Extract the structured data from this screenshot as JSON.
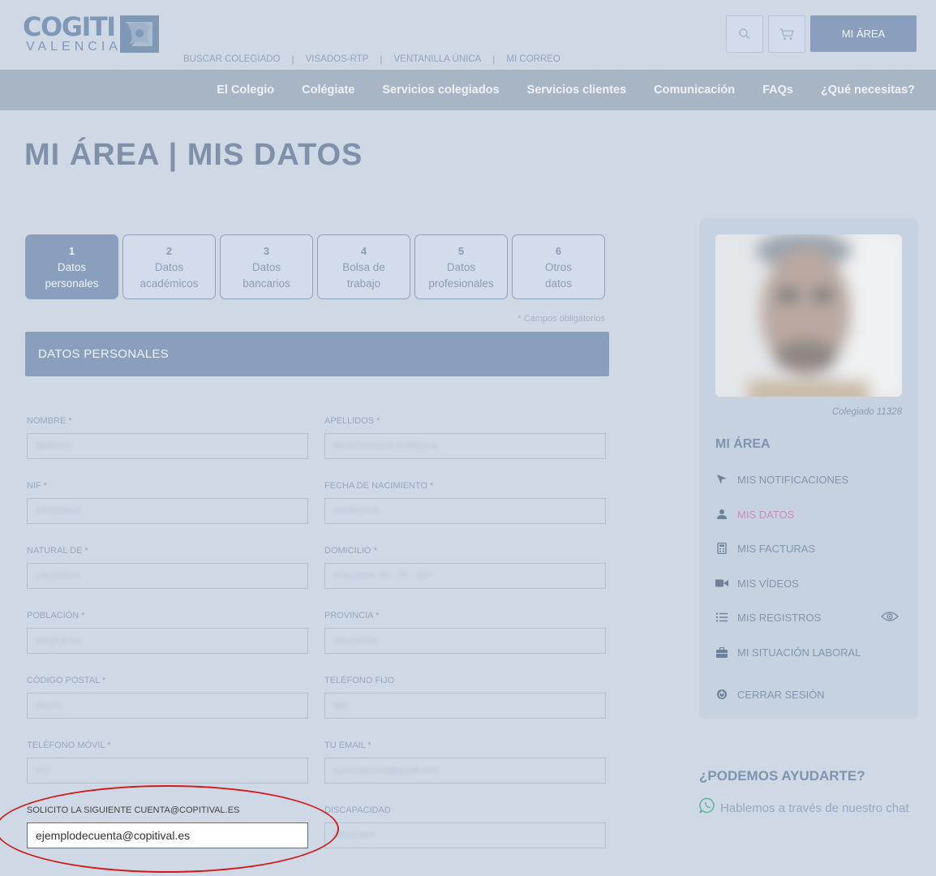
{
  "header": {
    "logo_main": "COGITI",
    "logo_sub": "VALENCIA",
    "top_links": [
      "BUSCAR COLEGIADO",
      "VISADOS-RTP",
      "VENTANILLA ÚNICA",
      "MI CORREO"
    ],
    "search_icon": "search-icon",
    "cart_icon": "cart-icon",
    "mi_area_label": "MI ÁREA"
  },
  "nav": {
    "items": [
      "El Colegio",
      "Colégiate",
      "Servicios colegiados",
      "Servicios clientes",
      "Comunicación",
      "FAQs",
      "¿Qué necesitas?"
    ]
  },
  "page": {
    "title": "MI ÁREA | MIS DATOS"
  },
  "tabs": [
    {
      "num": "1",
      "line1": "Datos",
      "line2": "personales",
      "active": true
    },
    {
      "num": "2",
      "line1": "Datos",
      "line2": "académicos",
      "active": false
    },
    {
      "num": "3",
      "line1": "Datos",
      "line2": "bancarios",
      "active": false
    },
    {
      "num": "4",
      "line1": "Bolsa de",
      "line2": "trabajo",
      "active": false
    },
    {
      "num": "5",
      "line1": "Datos",
      "line2": "profesionales",
      "active": false
    },
    {
      "num": "6",
      "line1": "Otros",
      "line2": "datos",
      "active": false
    }
  ],
  "form": {
    "required_note": "* Campos obligatorios",
    "section_title": "DATOS PERSONALES",
    "fields": {
      "nombre": {
        "label": "NOMBRE *",
        "value": "SERGIO"
      },
      "apellidos": {
        "label": "APELLIDOS *",
        "value": "MONTESINOS CORELLA"
      },
      "nif": {
        "label": "NIF *",
        "value": "29958384Z"
      },
      "fecha_nacimiento": {
        "label": "FECHA DE NACIMIENTO *",
        "value": "04/06/1978"
      },
      "natural_de": {
        "label": "NATURAL DE *",
        "value": "VALENCIA"
      },
      "domicilio": {
        "label": "DOMICILIO *",
        "value": "SOLLANA, 35 - 7P - 32F"
      },
      "poblacion": {
        "label": "POBLACIÓN *",
        "value": "MAQUERA"
      },
      "provincia": {
        "label": "PROVINCIA *",
        "value": "VALENCIA"
      },
      "codigo_postal": {
        "label": "CÓDIGO POSTAL *",
        "value": "46135"
      },
      "telefono_fijo": {
        "label": "TELÉFONO FIJO",
        "value": "961"
      },
      "telefono_movil": {
        "label": "TELÉFONO MÓVIL *",
        "value": "657"
      },
      "email": {
        "label": "TU EMAIL *",
        "value": "sgmontesinos@gmail.com"
      },
      "cuenta": {
        "label": "SOLICITO LA SIGUIENTE CUENTA@COPITIVAL.ES",
        "value": "ejemplodecuenta@copitival.es"
      },
      "discapacidad": {
        "label": "DISCAPACIDAD",
        "value": "NINGUNA"
      }
    }
  },
  "sidebar": {
    "colegiado": "Colegiado 11328",
    "title": "MI ÁREA",
    "items": [
      {
        "label": "MIS NOTIFICACIONES",
        "icon": "send-icon"
      },
      {
        "label": "MIS DATOS",
        "icon": "user-icon",
        "active": true
      },
      {
        "label": "MIS FACTURAS",
        "icon": "calculator-icon"
      },
      {
        "label": "MIS VÍDEOS",
        "icon": "video-icon"
      },
      {
        "label": "MIS REGISTROS",
        "icon": "list-icon"
      },
      {
        "label": "MI SITUACIÓN LABORAL",
        "icon": "briefcase-icon"
      },
      {
        "label": "CERRAR SESIÓN",
        "icon": "power-icon"
      }
    ]
  },
  "help": {
    "title": "¿PODEMOS AYUDARTE?",
    "chat_label": "Hablemos a través de nuestro chat"
  },
  "colors": {
    "background": "#cfd9e6",
    "accent": "#8a9fbd",
    "nav_bg": "#a8b5c5",
    "active_link": "#c48fbe",
    "highlight_ring": "#d11a1a",
    "whatsapp": "#5fb89a"
  }
}
